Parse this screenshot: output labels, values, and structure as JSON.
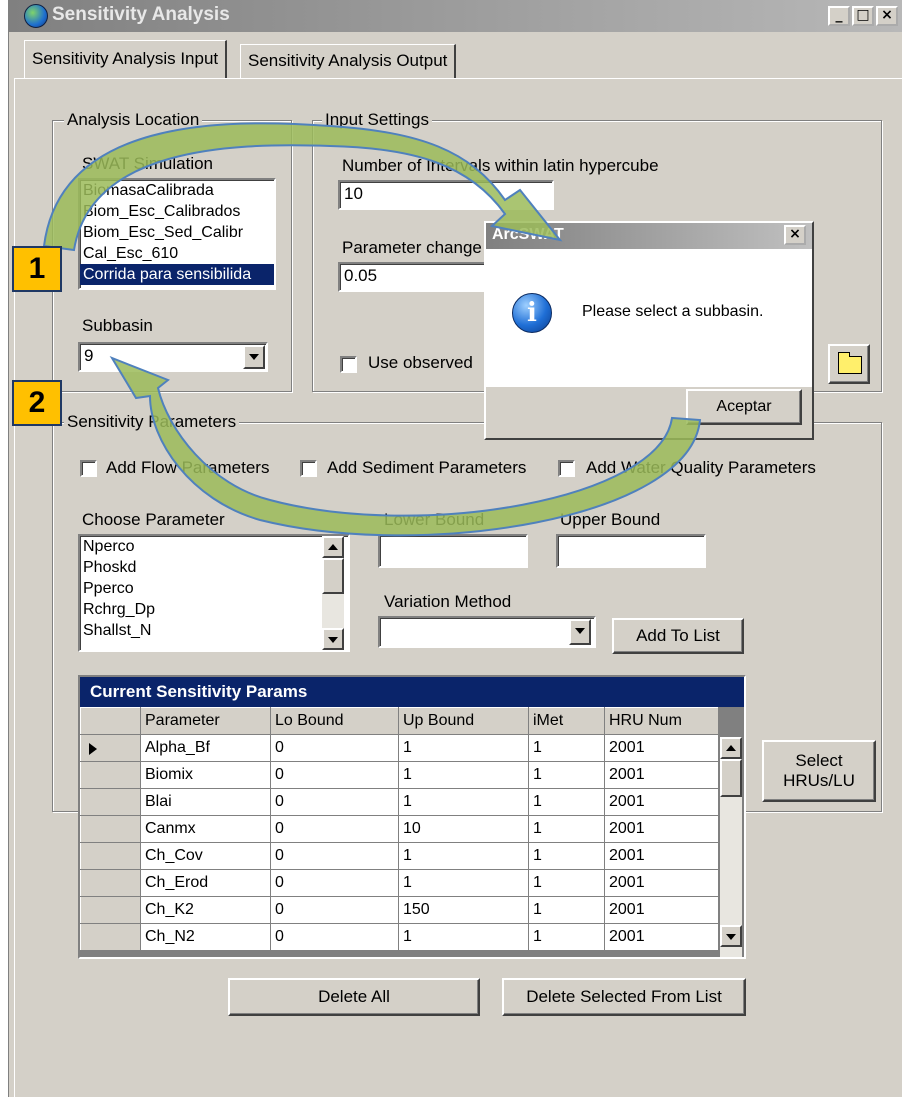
{
  "window": {
    "title": "Sensitivity Analysis",
    "buttons": {
      "minimize": "_",
      "maximize": "□",
      "close": "×"
    }
  },
  "tabs": [
    {
      "label": "Sensitivity Analysis Input",
      "active": true
    },
    {
      "label": "Sensitivity Analysis Output",
      "active": false
    }
  ],
  "analysis_location": {
    "legend": "Analysis Location",
    "swat_simulation_label": "SWAT Simulation",
    "simulations": [
      "BiomasaCalibrada",
      "Biom_Esc_Calibrados",
      "Biom_Esc_Sed_Calibr",
      "Cal_Esc_610",
      "Corrida para sensibilida"
    ],
    "selected_index": 4,
    "subbasin_label": "Subbasin",
    "subbasin_value": "9"
  },
  "input_settings": {
    "legend": "Input Settings",
    "intervals_label": "Number of Intervals within latin hypercube",
    "intervals_value": "10",
    "param_change_label": "Parameter change",
    "param_change_value": "0.05",
    "use_observed_label": "Use observed"
  },
  "sensitivity_parameters": {
    "legend": "Sensitivity Parameters",
    "add_flow": "Add Flow Parameters",
    "add_sediment": "Add Sediment Parameters",
    "add_water_quality": "Add Water Quality Parameters",
    "choose_parameter_label": "Choose Parameter",
    "parameters": [
      "Nperco",
      "Phoskd",
      "Pperco",
      "Rchrg_Dp",
      "Shallst_N"
    ],
    "lower_bound_label": "Lower Bound",
    "upper_bound_label": "Upper Bound",
    "lower_bound_value": "",
    "upper_bound_value": "",
    "variation_method_label": "Variation Method",
    "variation_method_value": "",
    "add_to_list": "Add To List"
  },
  "grid": {
    "caption": "Current Sensitivity Params",
    "columns": [
      "Parameter",
      "Lo Bound",
      "Up Bound",
      "iMet",
      "HRU Num"
    ],
    "rows": [
      [
        "Alpha_Bf",
        "0",
        "1",
        "1",
        "2001"
      ],
      [
        "Biomix",
        "0",
        "1",
        "1",
        "2001"
      ],
      [
        "Blai",
        "0",
        "1",
        "1",
        "2001"
      ],
      [
        "Canmx",
        "0",
        "10",
        "1",
        "2001"
      ],
      [
        "Ch_Cov",
        "0",
        "1",
        "1",
        "2001"
      ],
      [
        "Ch_Erod",
        "0",
        "1",
        "1",
        "2001"
      ],
      [
        "Ch_K2",
        "0",
        "150",
        "1",
        "2001"
      ],
      [
        "Ch_N2",
        "0",
        "1",
        "1",
        "2001"
      ]
    ]
  },
  "select_hrus": {
    "line1": "Select",
    "line2": "HRUs/LU"
  },
  "delete_all": "Delete All",
  "delete_selected": "Delete Selected From List",
  "dialog": {
    "title": "ArcSWAT",
    "message": "Please select a subbasin.",
    "ok": "Aceptar",
    "close": "×"
  },
  "callouts": {
    "one": "1",
    "two": "2"
  },
  "colors": {
    "callout_fill": "#ffc000",
    "arrow_fill": "#9bbb59",
    "selection": "#0a246a"
  }
}
